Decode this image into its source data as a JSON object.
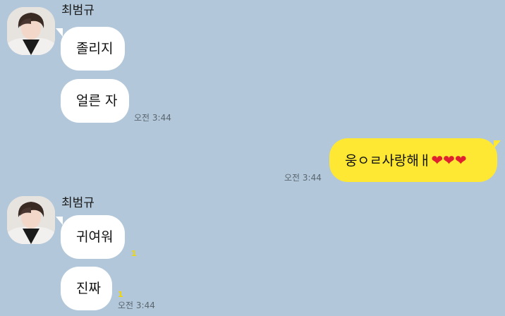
{
  "colors": {
    "background": "#b2c7d9",
    "incoming_bubble": "#ffffff",
    "outgoing_bubble": "#fee833",
    "heart": "#e0202e",
    "unread_count": "#f2d600"
  },
  "group1": {
    "sender": "최범규",
    "messages": [
      "졸리지",
      "얼른 자"
    ],
    "time": "오전 3:44"
  },
  "outgoing": {
    "text": "웅ㅇㄹ사랑해ㅐ",
    "hearts": "❤❤❤",
    "time": "오전 3:44"
  },
  "group2": {
    "sender": "최범규",
    "messages": [
      "귀여워",
      "진짜"
    ],
    "unread": [
      "1",
      "1"
    ],
    "time": "오전 3:44"
  }
}
